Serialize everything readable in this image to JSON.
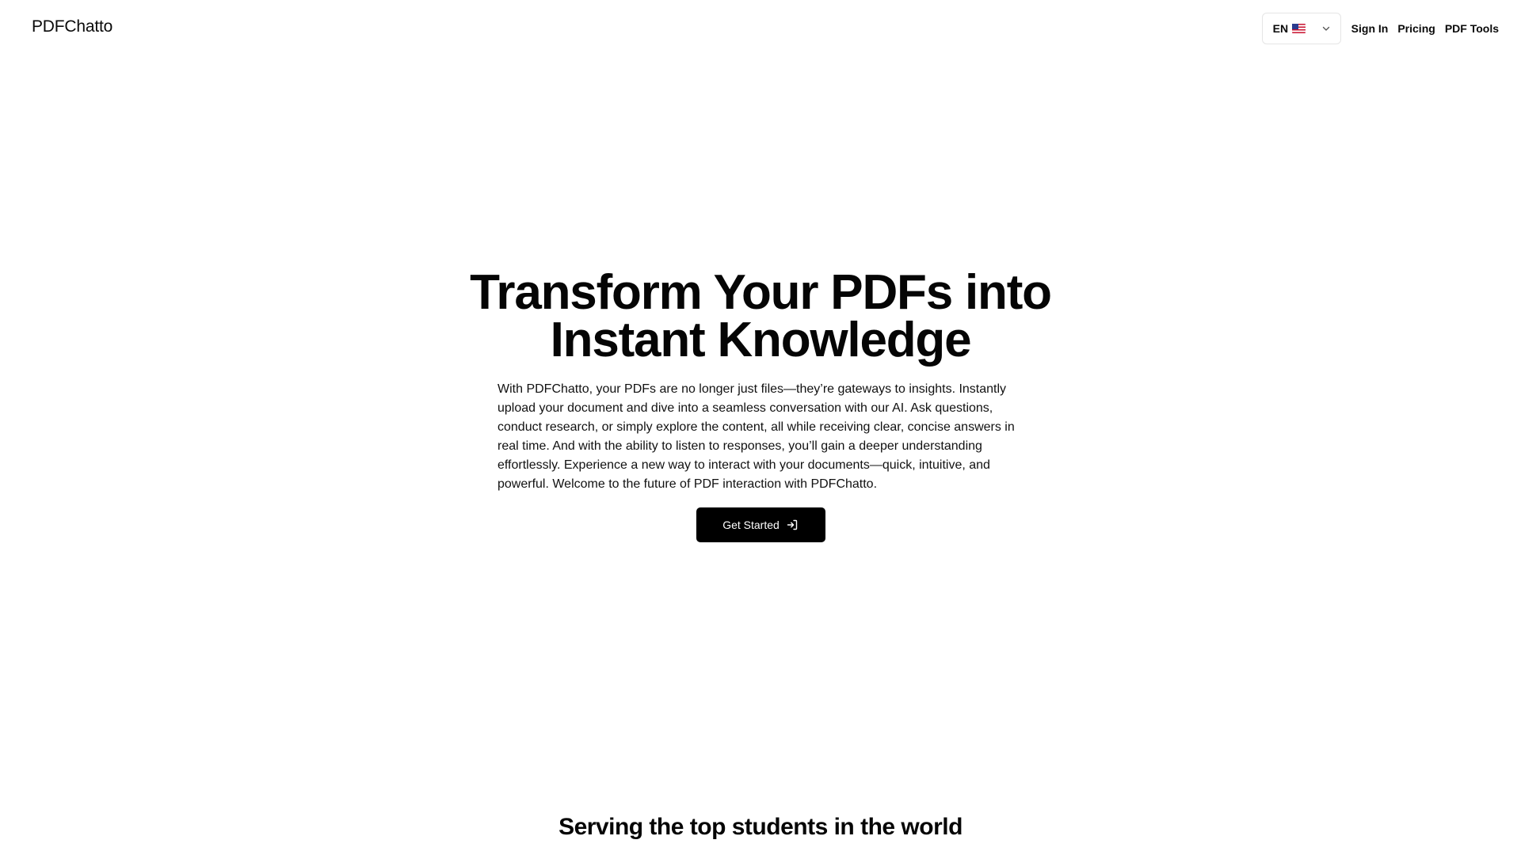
{
  "header": {
    "brand": "PDFChatto",
    "language": {
      "code": "EN",
      "flag_icon": "us-flag-icon"
    },
    "nav": {
      "sign_in": "Sign In",
      "pricing": "Pricing",
      "pdf_tools": "PDF Tools"
    }
  },
  "hero": {
    "title_line1": "Transform Your PDFs into",
    "title_line2": "Instant Knowledge",
    "description": "With PDFChatto, your PDFs are no longer just files—they’re gateways to insights. Instantly upload your document and dive into a seamless conversation with our AI. Ask questions, conduct research, or simply explore the content, all while receiving clear, concise answers in real time. And with the ability to listen to responses, you’ll gain a deeper understanding effortlessly. Experience a new way to interact with your documents—quick, intuitive, and powerful. Welcome to the future of PDF interaction with PDFChatto.",
    "cta_label": "Get Started",
    "cta_icon": "sign-in-arrow-icon"
  },
  "social_proof": {
    "heading": "Serving the top students in the world"
  },
  "colors": {
    "background": "#ffffff",
    "text": "#0a0a0a",
    "button_bg": "#000000",
    "button_text": "#ffffff",
    "border": "#e5e5e5"
  }
}
